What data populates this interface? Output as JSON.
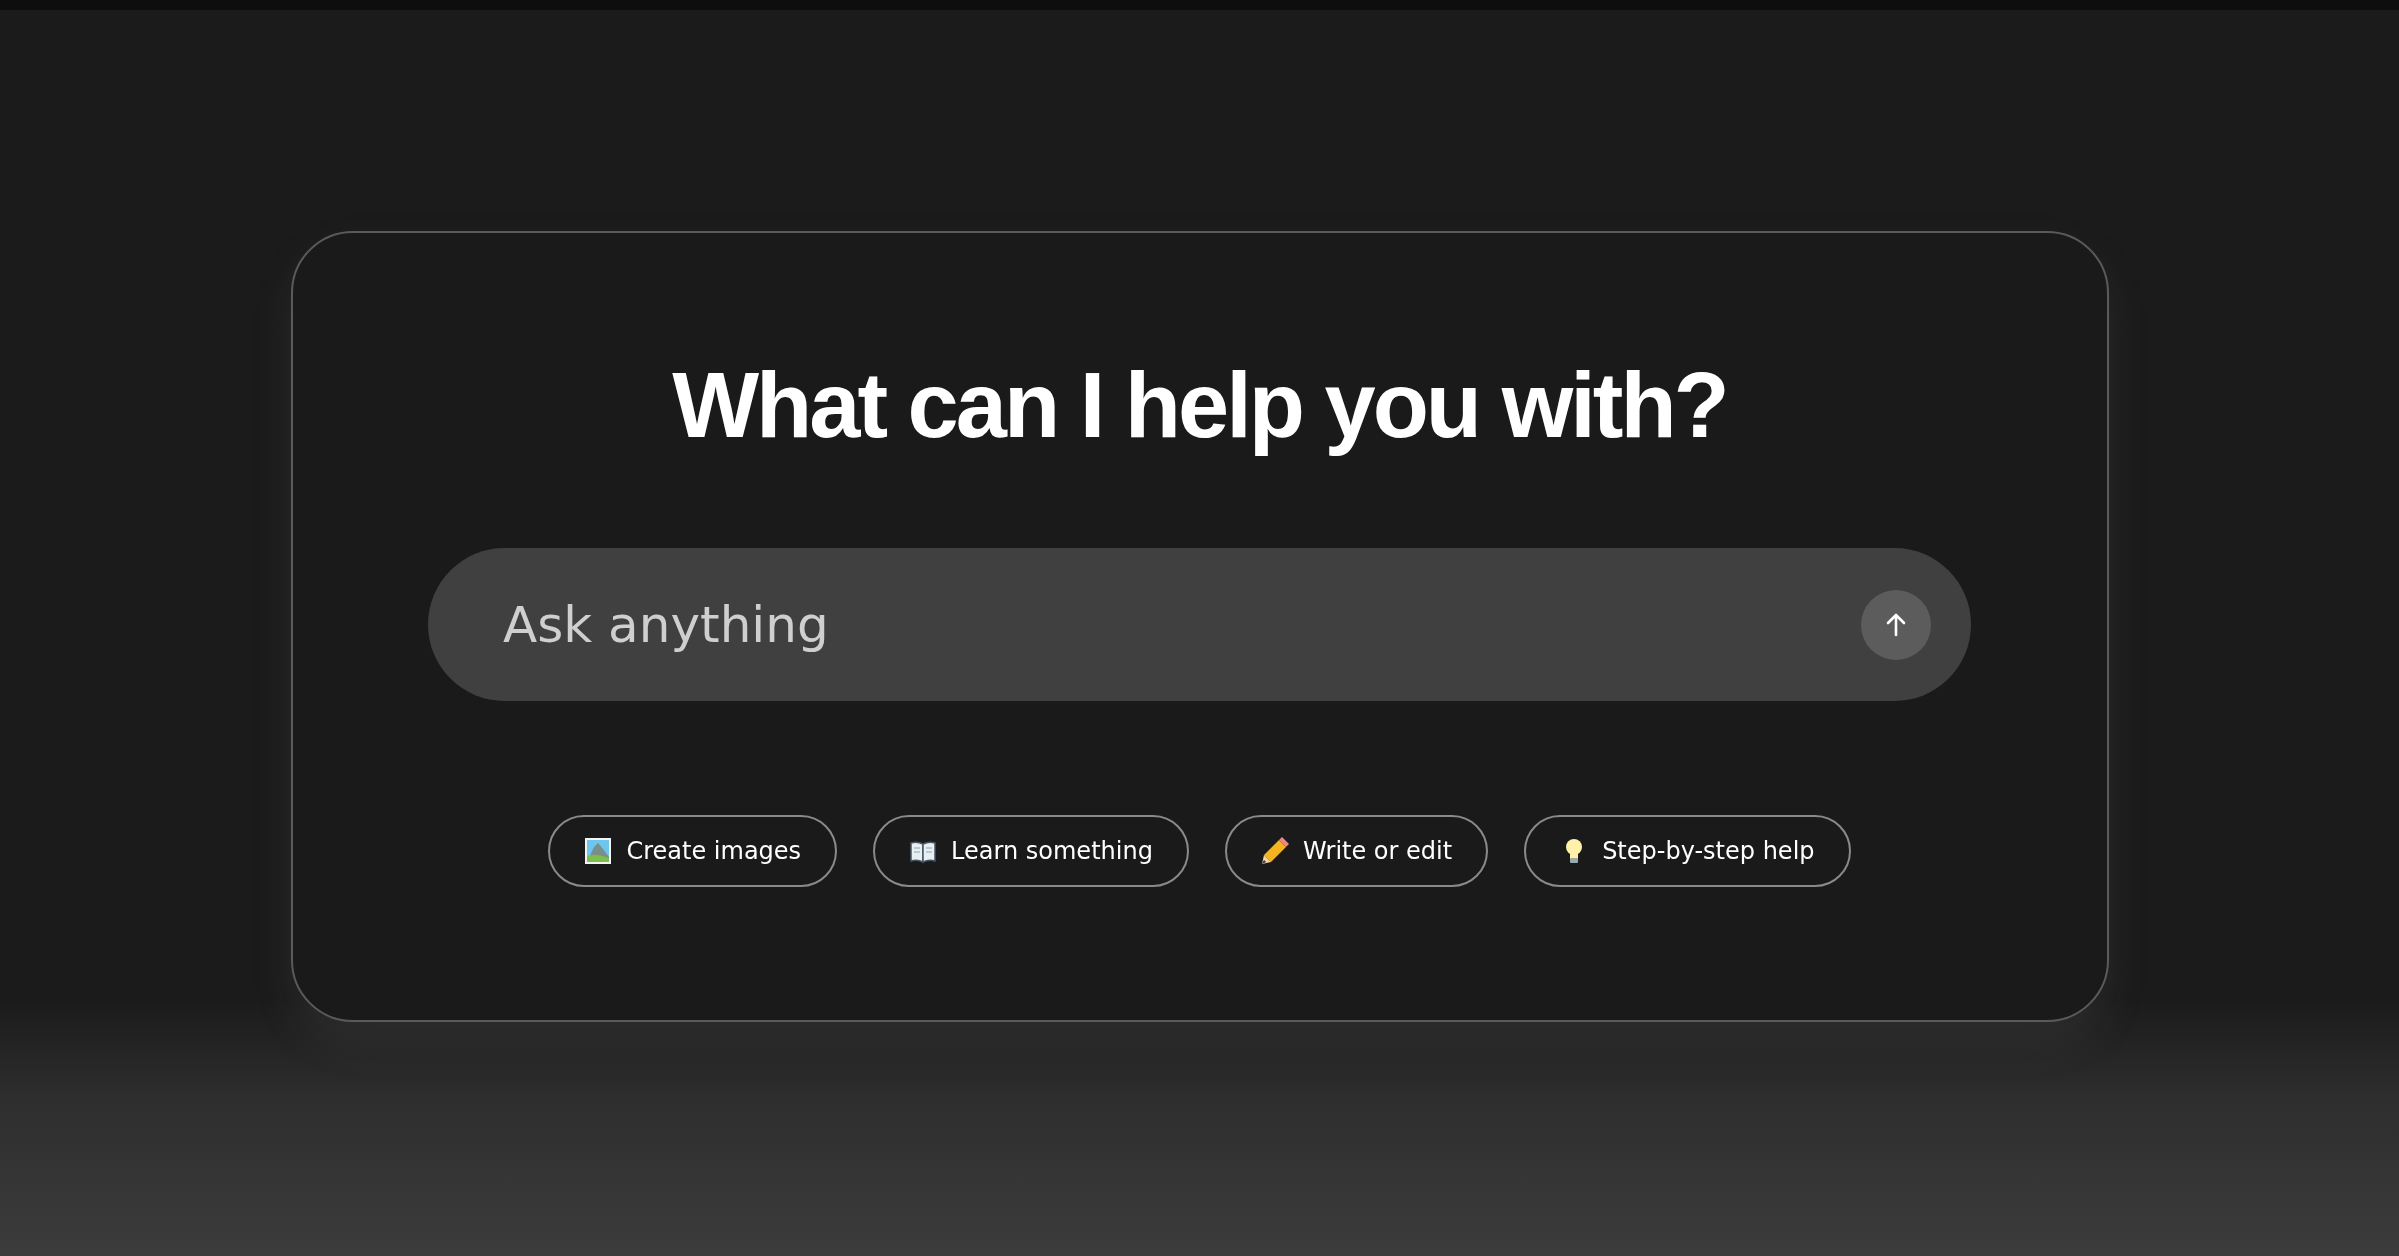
{
  "heading": "What can I help you with?",
  "prompt": {
    "placeholder": "Ask anything"
  },
  "suggestions": [
    {
      "label": "Create images",
      "kind": "picture"
    },
    {
      "label": "Learn something",
      "kind": "book"
    },
    {
      "label": "Write or edit",
      "kind": "pencil"
    },
    {
      "label": "Step-by-step help",
      "kind": "bulb"
    }
  ]
}
